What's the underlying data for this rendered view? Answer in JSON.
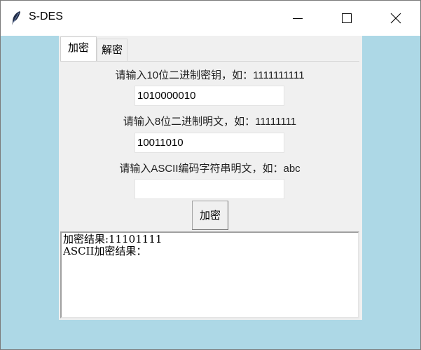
{
  "window": {
    "title": "S-DES",
    "controls": {
      "minimize": "minimize",
      "maximize": "maximize",
      "close": "close"
    }
  },
  "tabs": [
    {
      "label": "加密",
      "active": true
    },
    {
      "label": "解密",
      "active": false
    }
  ],
  "encrypt": {
    "key_label": "请输入10位二进制密钥，如：1111111111",
    "key_value": "1010000010",
    "plaintext_label": "请输入8位二进制明文，如：11111111",
    "plaintext_value": "10011010",
    "ascii_label": "请输入ASCII编码字符串明文，如：abc",
    "ascii_value": "",
    "encrypt_button": "加密"
  },
  "output": {
    "line1": "加密结果:11101111",
    "line2": "ASCII加密结果："
  },
  "colors": {
    "background": "#add8e6",
    "panel": "#f0f0f0",
    "titlebar": "#ffffff"
  }
}
